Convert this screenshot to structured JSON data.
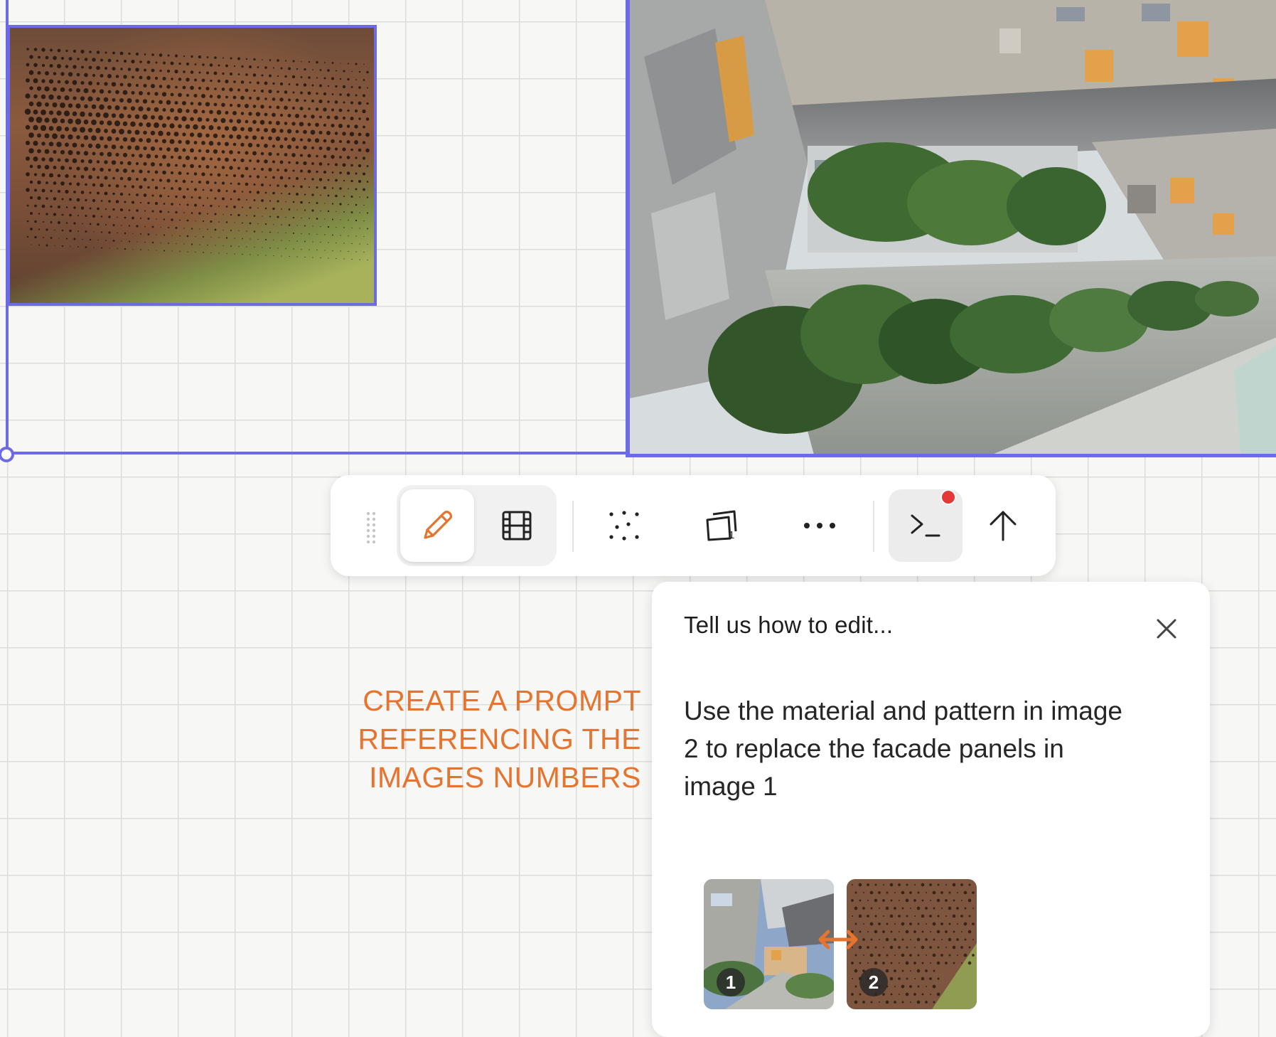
{
  "toolbar": {
    "buttons": [
      {
        "id": "edit",
        "icon": "pencil-icon",
        "active": true
      },
      {
        "id": "video",
        "icon": "film-icon"
      },
      {
        "id": "scatter",
        "icon": "scatter-dots-icon"
      },
      {
        "id": "frame",
        "icon": "frame-stack-icon"
      },
      {
        "id": "more",
        "icon": "more-horizontal-icon"
      },
      {
        "id": "terminal",
        "icon": "terminal-icon",
        "notification": true
      },
      {
        "id": "upload",
        "icon": "arrow-up-icon"
      }
    ],
    "frame_badge": "1",
    "accent_color": "#e6732e",
    "notification_color": "#e53935"
  },
  "edit_panel": {
    "title": "Tell us how to edit...",
    "prompt": "Use the material and pattern in image 2 to replace the facade panels in image 1",
    "thumbnails": [
      {
        "label": "1",
        "depicts": "building"
      },
      {
        "label": "2",
        "depicts": "perforated-metal"
      }
    ]
  },
  "annotation": {
    "lines": [
      "CREATE A PROMPT",
      "REFERENCING THE",
      "IMAGES NUMBERS"
    ],
    "color": "#e6732e"
  },
  "selection_color": "#6b6be6"
}
